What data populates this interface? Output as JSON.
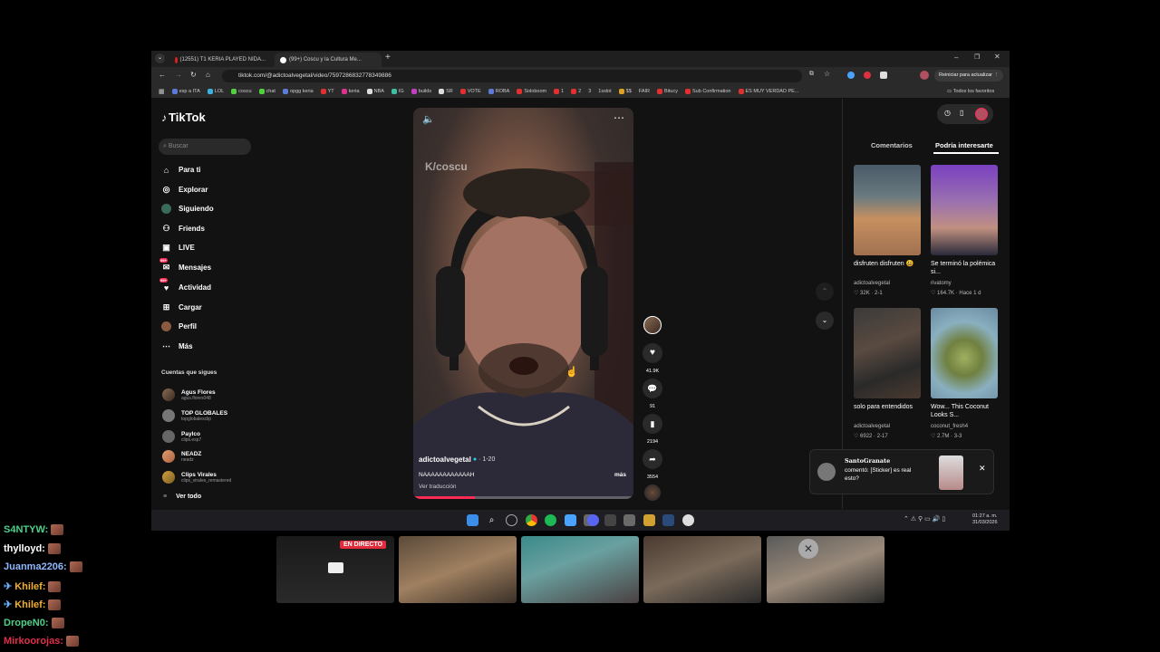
{
  "browser": {
    "tabs": [
      {
        "label": "(12551) T1 KERIA PLAYED NIDA..."
      },
      {
        "label": "(99+) Coscu y la Cultura Me..."
      }
    ],
    "url": "tiktok.com/@adictoalvegetal/video/7597286832778349886",
    "update_button": "Reiniciar para actualizar",
    "bookmarks": [
      "esp a ITA",
      "LOL",
      "coscu",
      "chat",
      "opgg keria",
      "YT",
      "keria",
      "NBA",
      "IG",
      "builds",
      "SR",
      "VOTE",
      "ROBA",
      "Soloboom",
      "1",
      "2",
      "3",
      "1sslot",
      "$$",
      "FAIR",
      "Bitucy",
      "Sub Confirmation",
      "ES MUY VERDAD PE..."
    ],
    "all_bookmarks": "Todos los favoritos"
  },
  "tiktok": {
    "logo": "TikTok",
    "search_placeholder": "Buscar",
    "nav": [
      {
        "label": "Para ti",
        "icon": "home-icon"
      },
      {
        "label": "Explorar",
        "icon": "compass-icon"
      },
      {
        "label": "Siguiendo",
        "icon": "following-icon"
      },
      {
        "label": "Friends",
        "icon": "friends-icon"
      },
      {
        "label": "LIVE",
        "icon": "live-icon"
      },
      {
        "label": "Mensajes",
        "icon": "messages-icon",
        "badge": "99+"
      },
      {
        "label": "Actividad",
        "icon": "activity-icon",
        "badge": "99+"
      },
      {
        "label": "Cargar",
        "icon": "upload-icon"
      },
      {
        "label": "Perfil",
        "icon": "profile-icon"
      },
      {
        "label": "Más",
        "icon": "more-icon"
      }
    ],
    "following_title": "Cuentas que sigues",
    "following": [
      {
        "name": "Agus Flores",
        "handle": "agus.flores048"
      },
      {
        "name": "TOP GLOBALES",
        "handle": "topglobalesclip"
      },
      {
        "name": "Paylco",
        "handle": "clips.esp7"
      },
      {
        "name": "NEADZ",
        "handle": "neadz"
      },
      {
        "name": "Clips Virales",
        "handle": "clips_virales_remastered"
      }
    ],
    "see_all": "Ver todo",
    "video": {
      "watermark": "K/coscu",
      "author": "adictoalvegetal",
      "date": "· 1-20",
      "caption": "NAAAAAAAAAAAAH",
      "more": "más",
      "translate": "Ver traducción"
    },
    "actions": {
      "likes": "41.9K",
      "comments": "91",
      "saves": "2194",
      "shares": "3554"
    },
    "right_tabs": [
      "Comentarios",
      "Podría interesarte"
    ],
    "suggestions": [
      {
        "caption": "disfruten disfruten 😃",
        "author": "adictoalvegetal",
        "stats": "32K · 2-1"
      },
      {
        "caption": "Se terminó la polémica si...",
        "author": "rivatomy",
        "stats": "164.7K · Hace 1 d"
      },
      {
        "caption": "solo para entendidos",
        "author": "adictoalvegetal",
        "stats": "6922 · 2-17"
      },
      {
        "caption": "Wow... This Coconut Looks S...",
        "author": "coconut_fresh4",
        "stats": "2.7M · 3-3"
      }
    ],
    "notification": {
      "user": "SantoGranate",
      "text": "comentó: [Sticker] es real esto?"
    }
  },
  "taskbar": {
    "time": "01:27 a. m.",
    "date": "31/03/2026"
  },
  "stream": {
    "live_badge": "EN DIRECTO",
    "chat": [
      {
        "user": "S4NTYW:",
        "color": "#4fd08a"
      },
      {
        "user": "thylloyd:",
        "color": "#ffffff"
      },
      {
        "user": "Juanma2206:",
        "color": "#8fb8ff"
      },
      {
        "user": "Khilef:",
        "color": "#f0b030"
      },
      {
        "user": "Khilef:",
        "color": "#f0b030"
      },
      {
        "user": "DropeN0:",
        "color": "#4fd08a"
      },
      {
        "user": "Mirkoorojas:",
        "color": "#e0304a"
      }
    ]
  }
}
